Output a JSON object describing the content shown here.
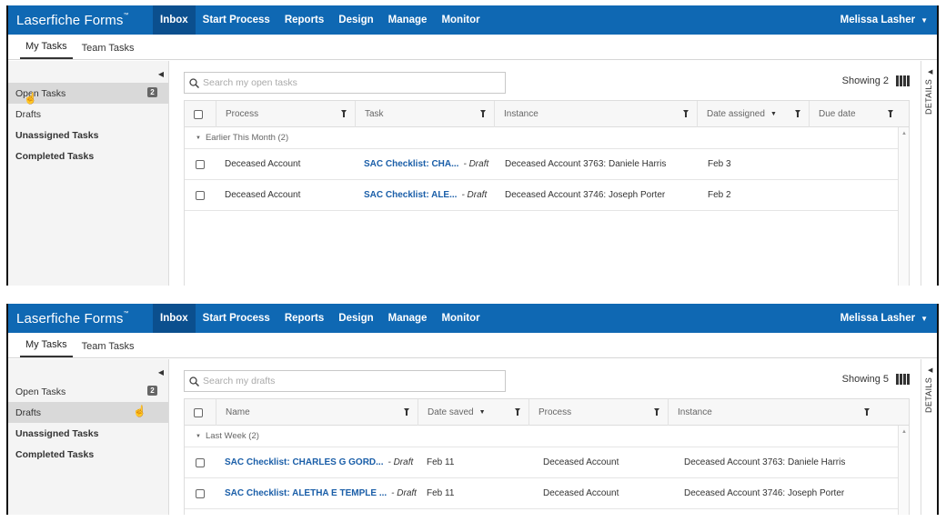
{
  "app": {
    "brand": "Laserfiche Forms",
    "brand_mark": "™",
    "nav": [
      "Inbox",
      "Start Process",
      "Reports",
      "Design",
      "Manage",
      "Monitor"
    ],
    "active_nav": "Inbox",
    "user": "Melissa Lasher",
    "subtabs": [
      "My Tasks",
      "Team Tasks"
    ],
    "active_subtab": "My Tasks",
    "sidebar_items": [
      {
        "label": "Open Tasks",
        "badge": "2"
      },
      {
        "label": "Drafts"
      },
      {
        "label": "Unassigned Tasks"
      },
      {
        "label": "Completed Tasks"
      }
    ],
    "details_label": "DETAILS"
  },
  "panel1": {
    "selected_sidebar": "Open Tasks",
    "search_placeholder": "Search my open tasks",
    "showing": "Showing 2",
    "columns": [
      "Process",
      "Task",
      "Instance",
      "Date assigned",
      "Due date"
    ],
    "group_label": "Earlier This Month (2)",
    "rows": [
      {
        "process": "Deceased Account",
        "task": "SAC Checklist: CHA...",
        "status": "- Draft",
        "instance": "Deceased Account 3763: Daniele Harris",
        "date": "Feb 3",
        "due": ""
      },
      {
        "process": "Deceased Account",
        "task": "SAC Checklist: ALE...",
        "status": "- Draft",
        "instance": "Deceased Account 3746: Joseph Porter",
        "date": "Feb 2",
        "due": ""
      }
    ]
  },
  "panel2": {
    "selected_sidebar": "Drafts",
    "search_placeholder": "Search my drafts",
    "showing": "Showing 5",
    "columns": [
      "Name",
      "Date saved",
      "Process",
      "Instance"
    ],
    "group_label": "Last Week (2)",
    "rows": [
      {
        "name": "SAC Checklist: CHARLES G GORD...",
        "status": "- Draft",
        "date": "Feb 11",
        "process": "Deceased Account",
        "instance": "Deceased Account 3763: Daniele Harris"
      },
      {
        "name": "SAC Checklist: ALETHA E TEMPLE ...",
        "status": "- Draft",
        "date": "Feb 11",
        "process": "Deceased Account",
        "instance": "Deceased Account 3746: Joseph Porter"
      }
    ]
  },
  "colors": {
    "topbar": "#0f68b3",
    "active_nav": "#0b4f8e",
    "link": "#1a5ea8",
    "sidebar_bg": "#f4f4f4",
    "sidebar_selected": "#d9d9d9"
  },
  "icons": [
    "search-icon",
    "filter-icon",
    "columns-icon",
    "collapse-left-icon",
    "chevron-down-icon",
    "expand-details-icon",
    "hand-cursor-icon"
  ]
}
